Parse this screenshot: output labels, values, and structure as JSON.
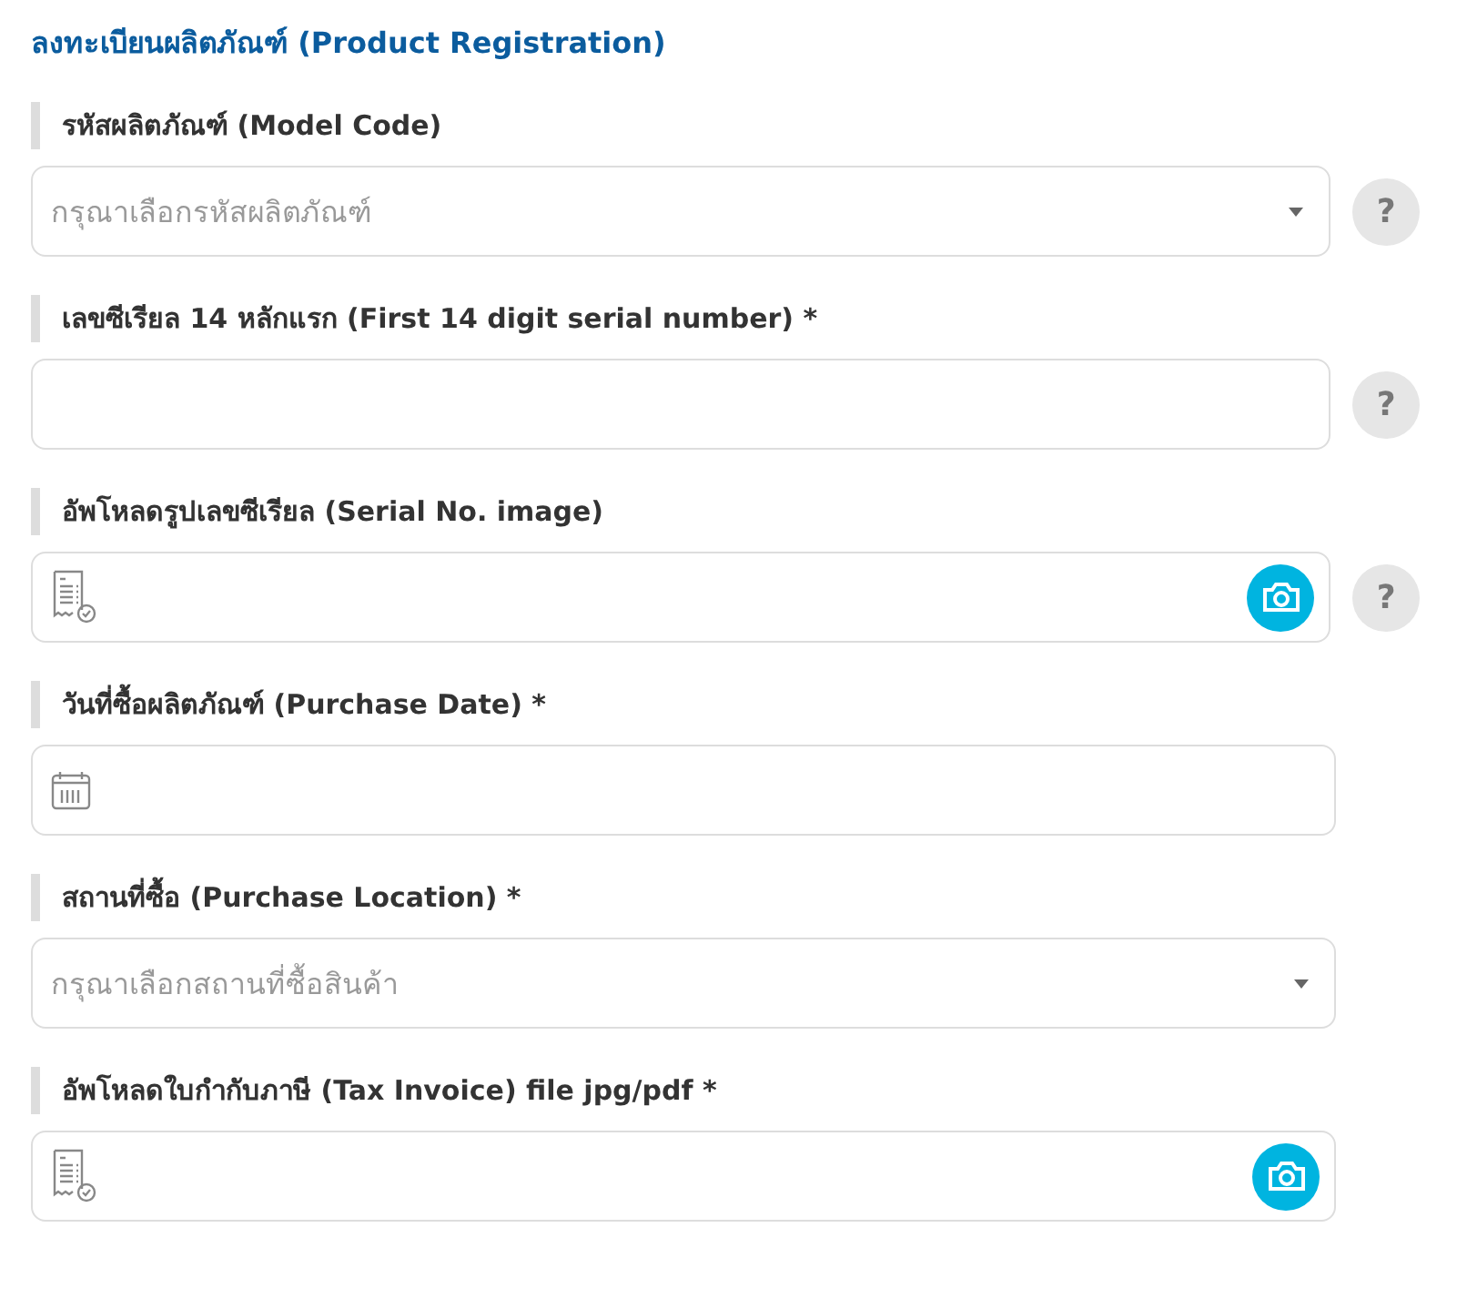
{
  "title": "ลงทะเบียนผลิตภัณฑ์ (Product Registration)",
  "fields": [
    {
      "kind": "select",
      "label": "รหัสผลิตภัณฑ์ (Model Code)",
      "placeholder": "กรุณาเลือกรหัสผลิตภัณฑ์",
      "help": "?"
    },
    {
      "kind": "text",
      "label": "เลขซีเรียล 14 หลักแรก (First 14 digit serial number) *",
      "help": "?"
    },
    {
      "kind": "upload",
      "label": "อัพโหลดรูปเลขซีเรียล (Serial No. image)",
      "help": "?"
    },
    {
      "kind": "date",
      "label": "วันที่ซื้อผลิตภัณฑ์ (Purchase Date) *"
    },
    {
      "kind": "select",
      "label": "สถานที่ซื้อ (Purchase Location) *",
      "placeholder": "กรุณาเลือกสถานที่ซื้อสินค้า"
    },
    {
      "kind": "upload",
      "label": "อัพโหลดใบกำกับภาษี (Tax Invoice) file jpg/pdf *"
    }
  ]
}
